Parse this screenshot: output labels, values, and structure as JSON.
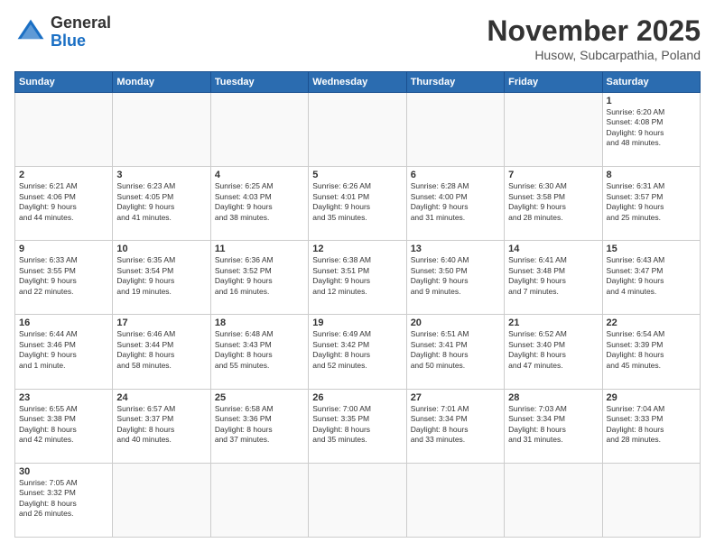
{
  "logo": {
    "line1": "General",
    "line2": "Blue"
  },
  "header": {
    "month": "November 2025",
    "location": "Husow, Subcarpathia, Poland"
  },
  "weekdays": [
    "Sunday",
    "Monday",
    "Tuesday",
    "Wednesday",
    "Thursday",
    "Friday",
    "Saturday"
  ],
  "weeks": [
    [
      {
        "day": "",
        "info": ""
      },
      {
        "day": "",
        "info": ""
      },
      {
        "day": "",
        "info": ""
      },
      {
        "day": "",
        "info": ""
      },
      {
        "day": "",
        "info": ""
      },
      {
        "day": "",
        "info": ""
      },
      {
        "day": "1",
        "info": "Sunrise: 6:20 AM\nSunset: 4:08 PM\nDaylight: 9 hours\nand 48 minutes."
      }
    ],
    [
      {
        "day": "2",
        "info": "Sunrise: 6:21 AM\nSunset: 4:06 PM\nDaylight: 9 hours\nand 44 minutes."
      },
      {
        "day": "3",
        "info": "Sunrise: 6:23 AM\nSunset: 4:05 PM\nDaylight: 9 hours\nand 41 minutes."
      },
      {
        "day": "4",
        "info": "Sunrise: 6:25 AM\nSunset: 4:03 PM\nDaylight: 9 hours\nand 38 minutes."
      },
      {
        "day": "5",
        "info": "Sunrise: 6:26 AM\nSunset: 4:01 PM\nDaylight: 9 hours\nand 35 minutes."
      },
      {
        "day": "6",
        "info": "Sunrise: 6:28 AM\nSunset: 4:00 PM\nDaylight: 9 hours\nand 31 minutes."
      },
      {
        "day": "7",
        "info": "Sunrise: 6:30 AM\nSunset: 3:58 PM\nDaylight: 9 hours\nand 28 minutes."
      },
      {
        "day": "8",
        "info": "Sunrise: 6:31 AM\nSunset: 3:57 PM\nDaylight: 9 hours\nand 25 minutes."
      }
    ],
    [
      {
        "day": "9",
        "info": "Sunrise: 6:33 AM\nSunset: 3:55 PM\nDaylight: 9 hours\nand 22 minutes."
      },
      {
        "day": "10",
        "info": "Sunrise: 6:35 AM\nSunset: 3:54 PM\nDaylight: 9 hours\nand 19 minutes."
      },
      {
        "day": "11",
        "info": "Sunrise: 6:36 AM\nSunset: 3:52 PM\nDaylight: 9 hours\nand 16 minutes."
      },
      {
        "day": "12",
        "info": "Sunrise: 6:38 AM\nSunset: 3:51 PM\nDaylight: 9 hours\nand 12 minutes."
      },
      {
        "day": "13",
        "info": "Sunrise: 6:40 AM\nSunset: 3:50 PM\nDaylight: 9 hours\nand 9 minutes."
      },
      {
        "day": "14",
        "info": "Sunrise: 6:41 AM\nSunset: 3:48 PM\nDaylight: 9 hours\nand 7 minutes."
      },
      {
        "day": "15",
        "info": "Sunrise: 6:43 AM\nSunset: 3:47 PM\nDaylight: 9 hours\nand 4 minutes."
      }
    ],
    [
      {
        "day": "16",
        "info": "Sunrise: 6:44 AM\nSunset: 3:46 PM\nDaylight: 9 hours\nand 1 minute."
      },
      {
        "day": "17",
        "info": "Sunrise: 6:46 AM\nSunset: 3:44 PM\nDaylight: 8 hours\nand 58 minutes."
      },
      {
        "day": "18",
        "info": "Sunrise: 6:48 AM\nSunset: 3:43 PM\nDaylight: 8 hours\nand 55 minutes."
      },
      {
        "day": "19",
        "info": "Sunrise: 6:49 AM\nSunset: 3:42 PM\nDaylight: 8 hours\nand 52 minutes."
      },
      {
        "day": "20",
        "info": "Sunrise: 6:51 AM\nSunset: 3:41 PM\nDaylight: 8 hours\nand 50 minutes."
      },
      {
        "day": "21",
        "info": "Sunrise: 6:52 AM\nSunset: 3:40 PM\nDaylight: 8 hours\nand 47 minutes."
      },
      {
        "day": "22",
        "info": "Sunrise: 6:54 AM\nSunset: 3:39 PM\nDaylight: 8 hours\nand 45 minutes."
      }
    ],
    [
      {
        "day": "23",
        "info": "Sunrise: 6:55 AM\nSunset: 3:38 PM\nDaylight: 8 hours\nand 42 minutes."
      },
      {
        "day": "24",
        "info": "Sunrise: 6:57 AM\nSunset: 3:37 PM\nDaylight: 8 hours\nand 40 minutes."
      },
      {
        "day": "25",
        "info": "Sunrise: 6:58 AM\nSunset: 3:36 PM\nDaylight: 8 hours\nand 37 minutes."
      },
      {
        "day": "26",
        "info": "Sunrise: 7:00 AM\nSunset: 3:35 PM\nDaylight: 8 hours\nand 35 minutes."
      },
      {
        "day": "27",
        "info": "Sunrise: 7:01 AM\nSunset: 3:34 PM\nDaylight: 8 hours\nand 33 minutes."
      },
      {
        "day": "28",
        "info": "Sunrise: 7:03 AM\nSunset: 3:34 PM\nDaylight: 8 hours\nand 31 minutes."
      },
      {
        "day": "29",
        "info": "Sunrise: 7:04 AM\nSunset: 3:33 PM\nDaylight: 8 hours\nand 28 minutes."
      }
    ],
    [
      {
        "day": "30",
        "info": "Sunrise: 7:05 AM\nSunset: 3:32 PM\nDaylight: 8 hours\nand 26 minutes."
      },
      {
        "day": "",
        "info": ""
      },
      {
        "day": "",
        "info": ""
      },
      {
        "day": "",
        "info": ""
      },
      {
        "day": "",
        "info": ""
      },
      {
        "day": "",
        "info": ""
      },
      {
        "day": "",
        "info": ""
      }
    ]
  ]
}
